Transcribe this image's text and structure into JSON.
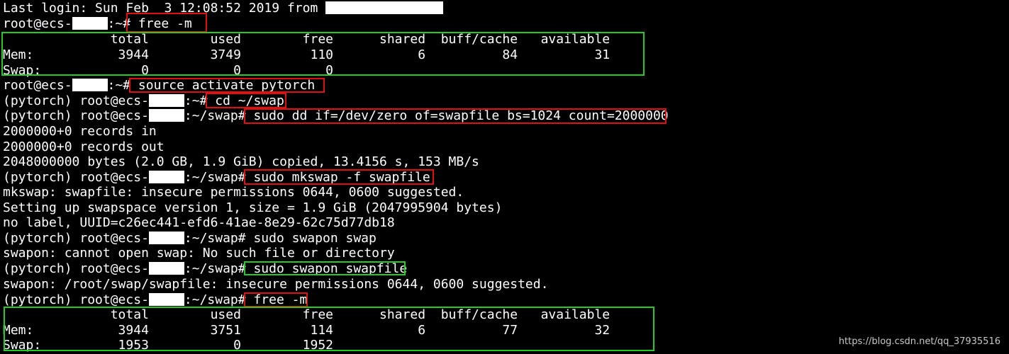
{
  "terminal": {
    "lines": [
      "Last login: Sun Feb  3 12:08:52 2019 from ",
      "root@ecs-",
      "free -m",
      "              total        used        free      shared  buff/cache   available",
      "Mem:           3944        3749         110           6          84          31",
      "Swap:             0           0           0",
      "root@ecs-",
      "source activate pytorch",
      "(pytorch) root@ecs-",
      "cd ~/swap",
      "(pytorch) root@ecs-",
      "sudo dd if=/dev/zero of=swapfile bs=1024 count=2000000",
      "2000000+0 records in",
      "2000000+0 records out",
      "2048000000 bytes (2.0 GB, 1.9 GiB) copied, 13.4156 s, 153 MB/s",
      "(pytorch) root@ecs-",
      "sudo mkswap -f swapfile",
      "mkswap: swapfile: insecure permissions 0644, 0600 suggested.",
      "Setting up swapspace version 1, size = 1.9 GiB (2047995904 bytes)",
      "no label, UUID=c26ec441-efd6-41ae-8e29-62c75d77db18",
      "(pytorch) root@ecs-",
      "sudo swapon swap",
      "swapon: cannot open swap: No such file or directory",
      "(pytorch) root@ecs-",
      "sudo swapon swapfile",
      "swapon: /root/swap/swapfile: insecure permissions 0644, 0600 suggested.",
      "(pytorch) root@ecs-",
      "free -m",
      "              total        used        free      shared  buff/cache   available",
      "Mem:           3944        3751         114           6          77          32",
      "Swap:          1953           0        1952"
    ],
    "prompt_suffixes": [
      ":~# ",
      ":~/swap# "
    ]
  },
  "watermark": "https://blog.csdn.net/qq_37935516",
  "colors": {
    "background": "#000000",
    "text": "#ffffff",
    "highlight_red": "#e01010",
    "highlight_green": "#22cc22",
    "redaction": "#ffffff"
  }
}
